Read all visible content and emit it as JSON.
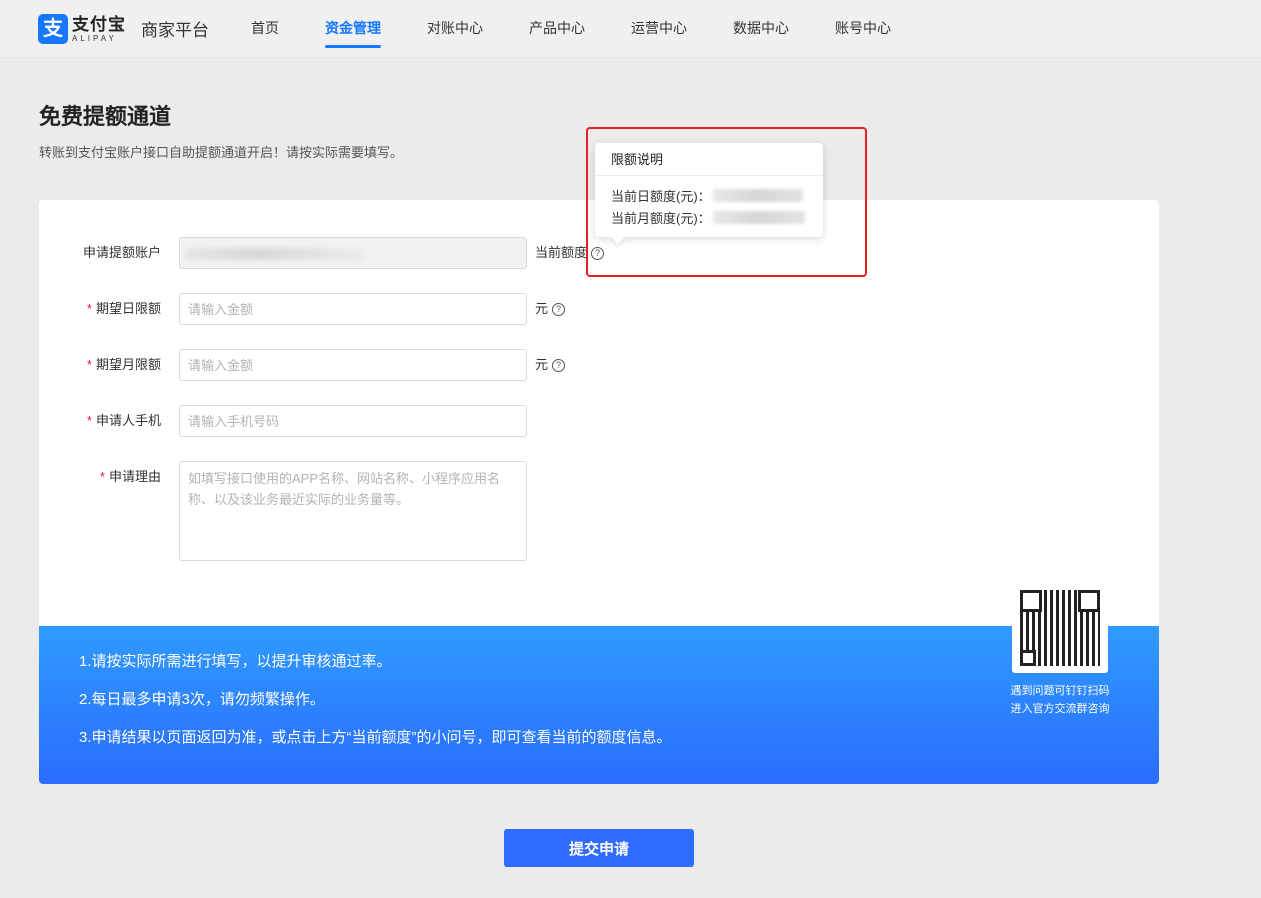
{
  "header": {
    "logo_cn": "支付宝",
    "logo_en": "ALIPAY",
    "logo_mark": "支",
    "platform": "商家平台",
    "nav": [
      {
        "label": "首页",
        "active": false
      },
      {
        "label": "资金管理",
        "active": true
      },
      {
        "label": "对账中心",
        "active": false
      },
      {
        "label": "产品中心",
        "active": false
      },
      {
        "label": "运营中心",
        "active": false
      },
      {
        "label": "数据中心",
        "active": false
      },
      {
        "label": "账号中心",
        "active": false
      }
    ]
  },
  "page": {
    "title": "免费提额通道",
    "subtitle": "转账到支付宝账户接口自助提额通道开启！请按实际需要填写。"
  },
  "form": {
    "account": {
      "label": "申请提额账户",
      "suffix": "当前额度"
    },
    "daily": {
      "label": "期望日限额",
      "placeholder": "请输入金额",
      "suffix": "元"
    },
    "monthly": {
      "label": "期望月限额",
      "placeholder": "请输入金额",
      "suffix": "元"
    },
    "phone": {
      "label": "申请人手机",
      "placeholder": "请输入手机号码"
    },
    "reason": {
      "label": "申请理由",
      "placeholder": "如填写接口使用的APP名称、网站名称、小程序应用名称、以及该业务最近实际的业务量等。"
    },
    "required_mark": "*",
    "help_glyph": "?"
  },
  "notice": {
    "lines": [
      "1.请按实际所需进行填写，以提升审核通过率。",
      "2.每日最多申请3次，请勿频繁操作。",
      "3.申请结果以页面返回为准，或点击上方“当前额度”的小问号，即可查看当前的额度信息。"
    ],
    "qr_caption_1": "遇到问题可钉钉扫码",
    "qr_caption_2": "进入官方交流群咨询"
  },
  "submit_label": "提交申请",
  "popover": {
    "title": "限额说明",
    "daily_label": "当前日额度(元)：",
    "monthly_label": "当前月额度(元)："
  },
  "colors": {
    "accent": "#1677ff",
    "highlight": "#e52222",
    "required": "#f5222d"
  }
}
